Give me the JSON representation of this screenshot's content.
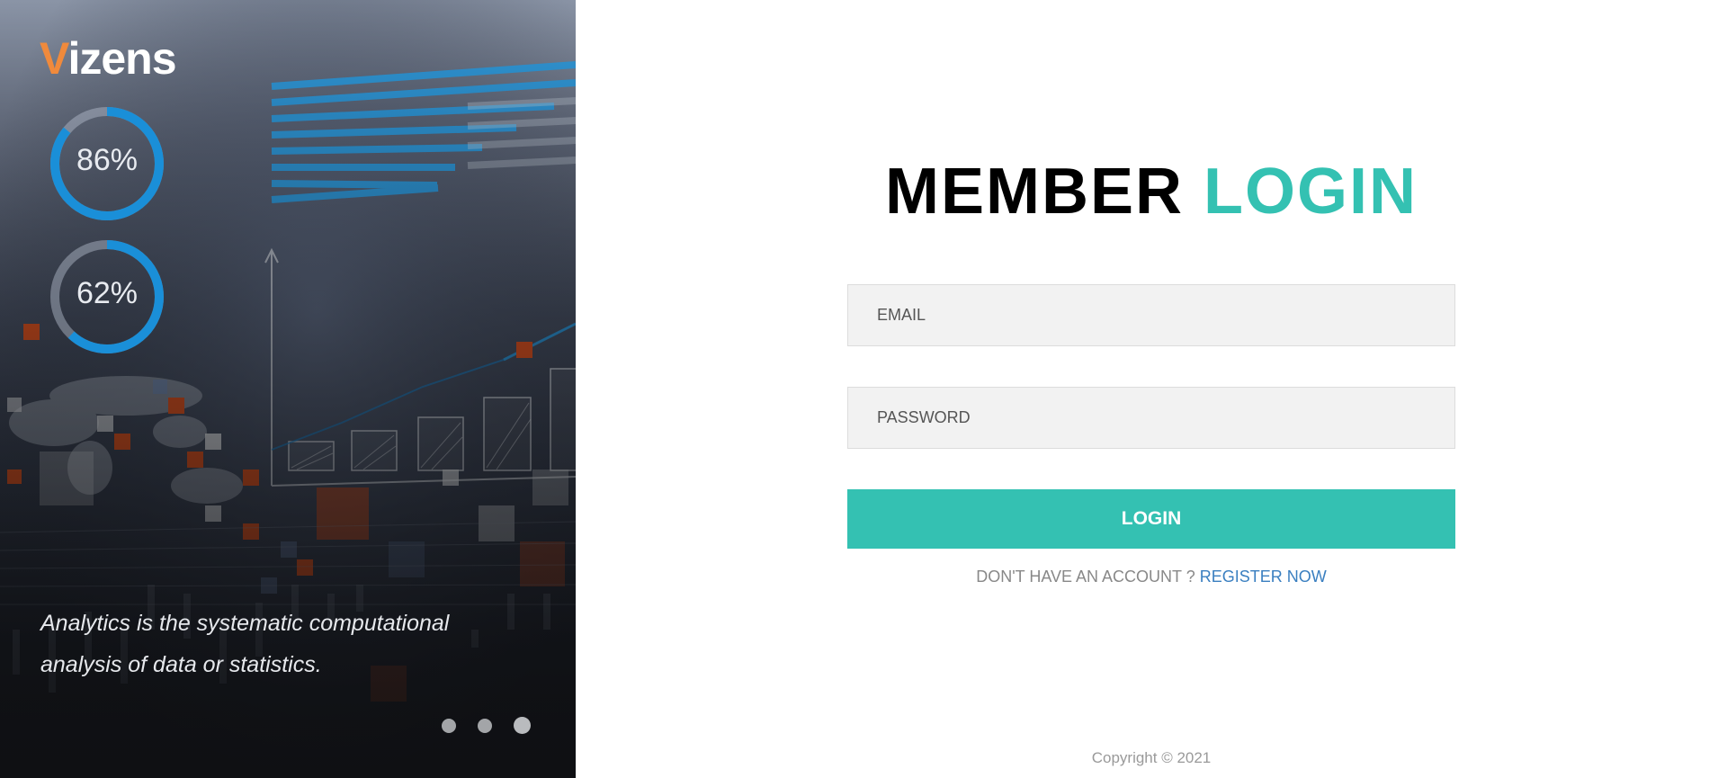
{
  "brand": {
    "first_letter": "V",
    "rest": "izens"
  },
  "hero": {
    "stats": [
      {
        "label": "86%",
        "value": 0.86
      },
      {
        "label": "62%",
        "value": 0.62
      }
    ],
    "tagline_line1": "Analytics is the systematic computational",
    "tagline_line2": "analysis of data or statistics.",
    "carousel": {
      "slides": 3,
      "active_index": 2
    }
  },
  "login": {
    "title_word1": "MEMBER",
    "title_word2": "LOGIN",
    "email_placeholder": "EMAIL",
    "password_placeholder": "PASSWORD",
    "submit_label": "LOGIN",
    "signup_prompt": "DON'T HAVE AN ACCOUNT ?",
    "signup_link": "REGISTER NOW",
    "copyright": "Copyright © 2021"
  },
  "colors": {
    "accent": "#34c1b2",
    "brand_orange": "#f08a3c",
    "link_blue": "#3a7fc0",
    "ring_blue": "#1a8fd8"
  }
}
